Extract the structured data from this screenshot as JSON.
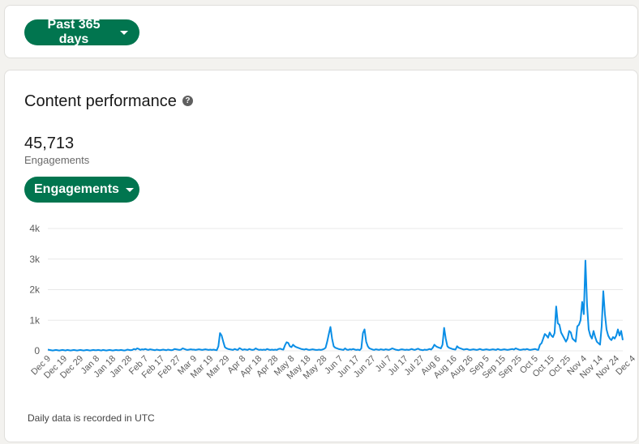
{
  "date_range": {
    "label": "Past 365 days",
    "icon": "caret-down-icon"
  },
  "content_performance": {
    "title": "Content performance",
    "help_icon": "question-circle-icon",
    "total_value": "45,713",
    "total_label": "Engagements",
    "metric_dropdown": {
      "label": "Engagements",
      "icon": "caret-down-icon"
    },
    "footnote": "Daily data is recorded in UTC"
  },
  "colors": {
    "accent": "#01754f",
    "line": "#0a8ee6",
    "grid": "#e8e8e8"
  },
  "chart_data": {
    "type": "line",
    "title": "",
    "xlabel": "",
    "ylabel": "",
    "ylim": [
      0,
      4000
    ],
    "y_ticks": [
      0,
      1000,
      2000,
      3000,
      4000
    ],
    "y_tick_labels": [
      "0",
      "1k",
      "2k",
      "3k",
      "4k"
    ],
    "x_tick_labels": [
      "Dec 9",
      "Dec 19",
      "Dec 29",
      "Jan 8",
      "Jan 18",
      "Jan 28",
      "Feb 7",
      "Feb 17",
      "Feb 27",
      "Mar 9",
      "Mar 19",
      "Mar 29",
      "Apr 8",
      "Apr 18",
      "Apr 28",
      "May 8",
      "May 18",
      "May 28",
      "Jun 7",
      "Jun 17",
      "Jun 27",
      "Jul 7",
      "Jul 17",
      "Jul 27",
      "Aug 6",
      "Aug 16",
      "Aug 26",
      "Sep 5",
      "Sep 15",
      "Sep 25",
      "Oct 5",
      "Oct 15",
      "Oct 25",
      "Nov 4",
      "Nov 14",
      "Nov 24",
      "Dec 4"
    ],
    "x_label_interval": 10,
    "grid": true,
    "legend": "none",
    "series": [
      {
        "values": [
          40,
          30,
          20,
          10,
          20,
          30,
          20,
          10,
          20,
          30,
          20,
          10,
          30,
          20,
          10,
          20,
          30,
          20,
          10,
          20,
          30,
          20,
          10,
          20,
          30,
          20,
          10,
          20,
          30,
          20,
          20,
          30,
          20,
          10,
          30,
          20,
          10,
          20,
          30,
          20,
          10,
          20,
          30,
          20,
          20,
          30,
          20,
          10,
          20,
          40,
          30,
          20,
          30,
          60,
          40,
          80,
          60,
          30,
          50,
          40,
          60,
          40,
          30,
          50,
          40,
          30,
          20,
          40,
          30,
          20,
          30,
          40,
          30,
          20,
          40,
          30,
          20,
          30,
          60,
          50,
          40,
          30,
          40,
          80,
          60,
          40,
          30,
          40,
          50,
          40,
          40,
          30,
          40,
          50,
          40,
          30,
          40,
          50,
          40,
          30,
          40,
          30,
          40,
          30,
          20,
          150,
          580,
          500,
          300,
          120,
          80,
          60,
          50,
          40,
          30,
          60,
          40,
          30,
          90,
          60,
          30,
          50,
          40,
          30,
          60,
          40,
          30,
          40,
          80,
          50,
          30,
          40,
          30,
          40,
          30,
          60,
          40,
          30,
          40,
          30,
          40,
          30,
          60,
          70,
          50,
          40,
          180,
          280,
          260,
          150,
          120,
          200,
          150,
          120,
          100,
          80,
          60,
          50,
          40,
          60,
          40,
          30,
          40,
          50,
          40,
          30,
          30,
          40,
          30,
          40,
          60,
          100,
          300,
          550,
          780,
          400,
          150,
          100,
          80,
          60,
          50,
          40,
          30,
          80,
          40,
          30,
          50,
          40,
          60,
          40,
          30,
          40,
          20,
          80,
          580,
          700,
          300,
          150,
          80,
          60,
          40,
          30,
          50,
          40,
          30,
          50,
          40,
          30,
          50,
          40,
          30,
          50,
          80,
          60,
          40,
          30,
          20,
          40,
          50,
          40,
          30,
          40,
          30,
          40,
          60,
          40,
          30,
          50,
          70,
          40,
          30,
          20,
          40,
          30,
          40,
          60,
          40,
          100,
          200,
          150,
          120,
          100,
          80,
          200,
          750,
          400,
          150,
          100,
          80,
          60,
          50,
          40,
          150,
          100,
          80,
          60,
          40,
          50,
          60,
          40,
          30,
          40,
          50,
          40,
          30,
          40,
          60,
          40,
          30,
          40,
          50,
          40,
          30,
          40,
          50,
          40,
          30,
          60,
          40,
          30,
          40,
          50,
          40,
          30,
          40,
          50,
          60,
          40,
          80,
          60,
          40,
          30,
          40,
          50,
          40,
          60,
          40,
          30,
          40,
          50,
          60,
          40,
          30,
          200,
          250,
          400,
          550,
          500,
          430,
          600,
          500,
          450,
          580,
          1450,
          900,
          850,
          600,
          500,
          400,
          300,
          400,
          650,
          600,
          400,
          350,
          300,
          800,
          850,
          1000,
          1600,
          1200,
          2950,
          1500,
          700,
          500,
          400,
          650,
          450,
          300,
          250,
          200,
          800,
          1950,
          1200,
          700,
          500,
          400,
          350,
          450,
          400,
          500,
          700,
          500,
          650,
          350
        ]
      }
    ]
  }
}
